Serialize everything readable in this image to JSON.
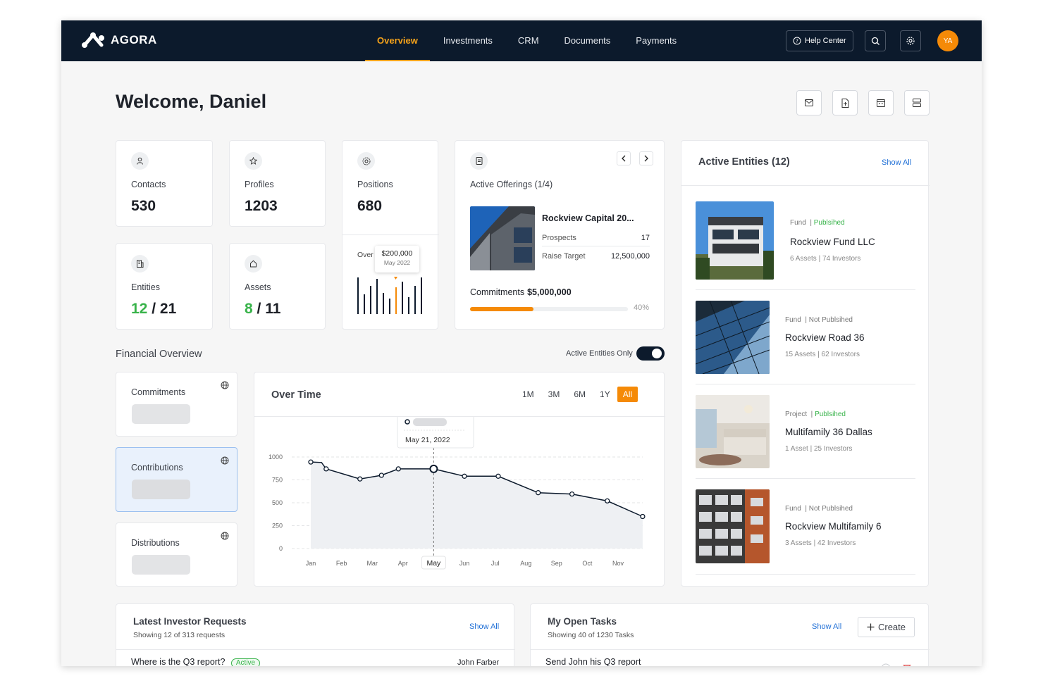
{
  "app": {
    "name": "AGORA"
  },
  "nav": [
    {
      "label": "Overview",
      "active": true
    },
    {
      "label": "Investments",
      "active": false
    },
    {
      "label": "CRM",
      "active": false
    },
    {
      "label": "Documents",
      "active": false
    },
    {
      "label": "Payments",
      "active": false
    }
  ],
  "header": {
    "help_label": "Help Center",
    "avatar_initials": "YA"
  },
  "welcome": "Welcome, Daniel",
  "stats": {
    "contacts": {
      "label": "Contacts",
      "value": "530"
    },
    "profiles": {
      "label": "Profiles",
      "value": "1203"
    },
    "positions": {
      "label": "Positions",
      "value": "680"
    },
    "entities": {
      "label": "Entities",
      "active": "12",
      "sep": "/",
      "total": "21"
    },
    "assets": {
      "label": "Assets",
      "active": "8",
      "sep": "/",
      "total": "11"
    }
  },
  "positions_mini": {
    "over_label": "Over",
    "tooltip_value": "$200,000",
    "tooltip_date": "May 2022"
  },
  "offerings": {
    "label": "Active Offerings (1/4)",
    "name": "Rockview Capital 20...",
    "prospects_label": "Prospects",
    "prospects_value": "17",
    "raise_label": "Raise Target",
    "raise_value": "12,500,000",
    "commitments_label": "Commitments",
    "commitments_value": "$5,000,000",
    "progress_pct": 40,
    "progress_text": "40%"
  },
  "financial": {
    "title": "Financial Overview",
    "toggle_label": "Active Entities Only",
    "cards": [
      "Commitments",
      "Contributions",
      "Distributions"
    ]
  },
  "over_time": {
    "title": "Over Time",
    "ranges": [
      "1M",
      "3M",
      "6M",
      "1Y",
      "All"
    ],
    "active_range": "All",
    "tooltip_date": "May 21, 2022"
  },
  "chart_data": {
    "type": "area",
    "categories": [
      "Jan",
      "Feb",
      "Mar",
      "Apr",
      "May",
      "Jun",
      "Jul",
      "Aug",
      "Sep",
      "Oct",
      "Nov"
    ],
    "yticks": [
      "1000",
      "750",
      "500",
      "250",
      "0"
    ],
    "ylim": [
      0,
      1000
    ],
    "points": [
      {
        "x": 0.0,
        "y": 945
      },
      {
        "x": 0.35,
        "y": 940
      },
      {
        "x": 0.5,
        "y": 870
      },
      {
        "x": 1.6,
        "y": 760
      },
      {
        "x": 2.3,
        "y": 800
      },
      {
        "x": 2.85,
        "y": 870
      },
      {
        "x": 3.85,
        "y": 870
      },
      {
        "x": 4.0,
        "y": 870
      },
      {
        "x": 5.0,
        "y": 790
      },
      {
        "x": 6.1,
        "y": 790
      },
      {
        "x": 7.4,
        "y": 610
      },
      {
        "x": 8.5,
        "y": 595
      },
      {
        "x": 9.65,
        "y": 520
      },
      {
        "x": 10.8,
        "y": 350
      }
    ],
    "highlight": {
      "x": 4.0,
      "y": 870,
      "label": "May"
    }
  },
  "active_entities": {
    "title": "Active Entities (12)",
    "show_all": "Show All",
    "items": [
      {
        "type": "Fund",
        "status": "Publsihed",
        "published": true,
        "name": "Rockview Fund LLC",
        "meta": "6 Assets  |  74 Investors"
      },
      {
        "type": "Fund",
        "status": "Not Publsihed",
        "published": false,
        "name": "Rockview Road 36",
        "meta": "15 Assets  |  62 Investors"
      },
      {
        "type": "Project",
        "status": "Publsihed",
        "published": true,
        "name": "Multifamily 36 Dallas",
        "meta": "1 Asset  |  25 Investors"
      },
      {
        "type": "Fund",
        "status": "Not Publsihed",
        "published": false,
        "name": "Rockview Multifamily 6",
        "meta": "3 Assets  |  42 Investors"
      }
    ]
  },
  "investor_requests": {
    "title": "Latest Investor Requests",
    "subtitle": "Showing 12 of 313 requests",
    "show_all": "Show All",
    "row": {
      "text": "Where is the Q3 report?",
      "status": "Active",
      "owner": "John Farber"
    }
  },
  "tasks": {
    "title": "My Open Tasks",
    "subtitle": "Showing 40 of 1230 Tasks",
    "show_all": "Show All",
    "create_label": "Create",
    "row": {
      "text": "Send John his Q3 report"
    }
  }
}
